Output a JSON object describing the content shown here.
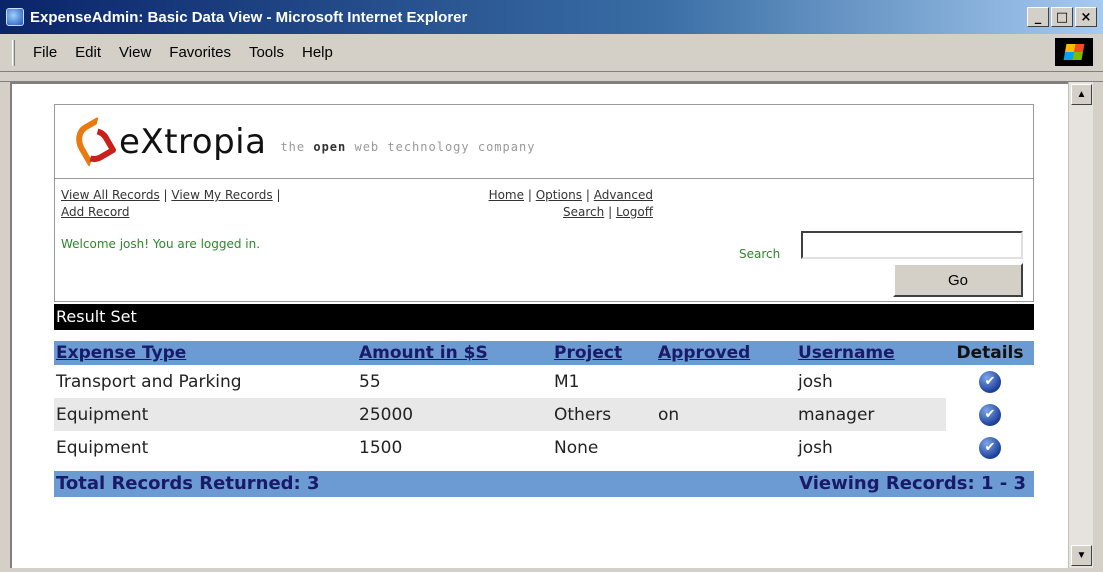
{
  "window": {
    "title": "ExpenseAdmin: Basic Data View - Microsoft Internet Explorer",
    "buttons": [
      "_",
      "□",
      "×"
    ]
  },
  "menubar": {
    "items": [
      "File",
      "Edit",
      "View",
      "Favorites",
      "Tools",
      "Help"
    ]
  },
  "logo": {
    "name": "eXtropia",
    "tagline_pre": "the ",
    "tagline_bold": "open",
    "tagline_post": " web technology company"
  },
  "nav": {
    "view_all": "View All Records",
    "view_my": "View My Records",
    "add_record": "Add Record",
    "home": "Home",
    "options": "Options",
    "advanced": "Advanced",
    "search": "Search",
    "logoff": "Logoff",
    "separator": "|"
  },
  "welcome": "Welcome josh! You are logged in.",
  "search": {
    "label": "Search",
    "value": "",
    "go_label": "Go"
  },
  "result_set_title": "Result Set",
  "table": {
    "headers": [
      "Expense Type",
      "Amount in $S",
      "Project",
      "Approved",
      "Username",
      "Details"
    ],
    "rows": [
      {
        "type": "Transport and Parking",
        "amount": "55",
        "project": "M1",
        "approved": "",
        "username": "josh"
      },
      {
        "type": "Equipment",
        "amount": "25000",
        "project": "Others",
        "approved": "on",
        "username": "manager"
      },
      {
        "type": "Equipment",
        "amount": "1500",
        "project": "None",
        "approved": "",
        "username": "josh"
      }
    ]
  },
  "footer": {
    "total": "Total Records Returned: 3",
    "viewing": "Viewing Records: 1 - 3"
  },
  "colors": {
    "header_blue": "#6b9bd2",
    "welcome_green": "#2a8a2a",
    "logo_orange": "#e87a10",
    "logo_red": "#c8201a"
  }
}
